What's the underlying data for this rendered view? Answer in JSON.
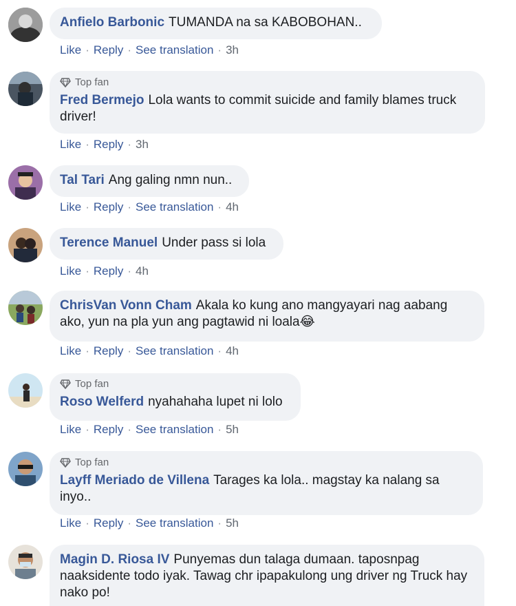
{
  "comments": [
    {
      "author": "Anfielo Barbonic",
      "text": "TUMANDA na sa KABOBOHAN..",
      "top_fan": false,
      "actions": {
        "like": "Like",
        "reply": "Reply",
        "translate": "See translation",
        "time": "3h"
      }
    },
    {
      "author": "Fred Bermejo",
      "text": "Lola wants to commit suicide and family blames truck driver!",
      "top_fan": true,
      "badge": "Top fan",
      "actions": {
        "like": "Like",
        "reply": "Reply",
        "time": "3h"
      }
    },
    {
      "author": "Tal Tari",
      "text": "Ang galing nmn nun..",
      "top_fan": false,
      "actions": {
        "like": "Like",
        "reply": "Reply",
        "translate": "See translation",
        "time": "4h"
      }
    },
    {
      "author": "Terence Manuel",
      "text": "Under pass si lola",
      "top_fan": false,
      "actions": {
        "like": "Like",
        "reply": "Reply",
        "time": "4h"
      }
    },
    {
      "author": "ChrisVan Vonn Cham",
      "text": "Akala ko kung ano mangyayari nag aabang ako, yun na pla yun ang pagtawid ni loala",
      "emoji": "😂",
      "top_fan": false,
      "actions": {
        "like": "Like",
        "reply": "Reply",
        "translate": "See translation",
        "time": "4h"
      }
    },
    {
      "author": "Roso Welferd",
      "text": "nyahahaha lupet ni lolo",
      "top_fan": true,
      "badge": "Top fan",
      "actions": {
        "like": "Like",
        "reply": "Reply",
        "translate": "See translation",
        "time": "5h"
      }
    },
    {
      "author": "Layff Meriado de Villena",
      "text": "Tarages ka lola.. magstay ka nalang sa inyo..",
      "top_fan": true,
      "badge": "Top fan",
      "actions": {
        "like": "Like",
        "reply": "Reply",
        "translate": "See translation",
        "time": "5h"
      }
    },
    {
      "author": "Magin D. Riosa IV",
      "text": "Punyemas dun talaga dumaan. taposnpag naaksidente todo iyak. Tawag chr ipapakulong ung driver ng Truck hay nako po!",
      "top_fan": false
    }
  ],
  "colors": {
    "author": "#385898",
    "bubble": "#f0f2f5",
    "meta": "#65676b"
  }
}
